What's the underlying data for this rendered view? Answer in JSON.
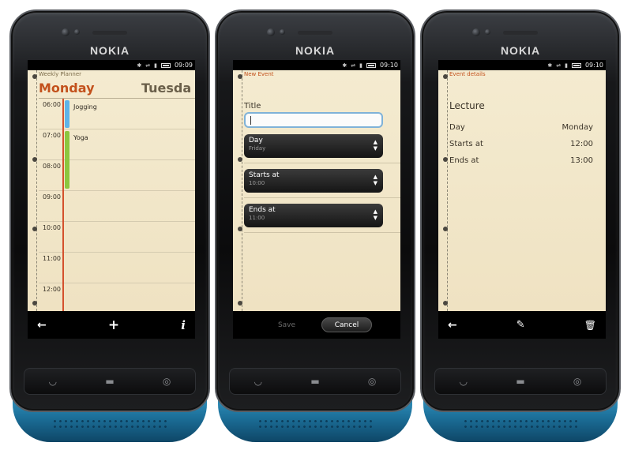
{
  "phones": [
    {
      "brand": "NOKIA",
      "status": {
        "time": "09:09"
      },
      "app_title": "Weekly Planner",
      "day": "Monday",
      "next_day": "Tuesda",
      "hours": [
        "06:00",
        "07:00",
        "08:00",
        "09:00",
        "10:00",
        "11:00",
        "12:00"
      ],
      "events": [
        {
          "name": "Jogging",
          "color": "#5fb3e8"
        },
        {
          "name": "Yoga",
          "color": "#8cc63f"
        }
      ],
      "toolbar": {
        "back": "back-arrow-icon",
        "add": "plus-icon",
        "info": "info-icon"
      }
    },
    {
      "brand": "NOKIA",
      "status": {
        "time": "09:10"
      },
      "app_title": "New Event",
      "title_label": "Title",
      "title_value": "",
      "fields": [
        {
          "label": "Day",
          "value": "Friday"
        },
        {
          "label": "Starts at",
          "value": "10:00"
        },
        {
          "label": "Ends at",
          "value": "11:00"
        }
      ],
      "buttons": {
        "save": "Save",
        "cancel": "Cancel"
      }
    },
    {
      "brand": "NOKIA",
      "status": {
        "time": "09:10"
      },
      "app_title": "Event details",
      "event_name": "Lecture",
      "rows": [
        {
          "label": "Day",
          "value": "Monday"
        },
        {
          "label": "Starts at",
          "value": "12:00"
        },
        {
          "label": "Ends at",
          "value": "13:00"
        }
      ],
      "toolbar": {
        "back": "back-arrow-icon",
        "edit": "pencil-icon",
        "delete": "trash-icon"
      }
    }
  ],
  "colors": {
    "paper": "#f1e6c8",
    "accent": "#c3511c",
    "device_band": "#2a8bbb"
  }
}
